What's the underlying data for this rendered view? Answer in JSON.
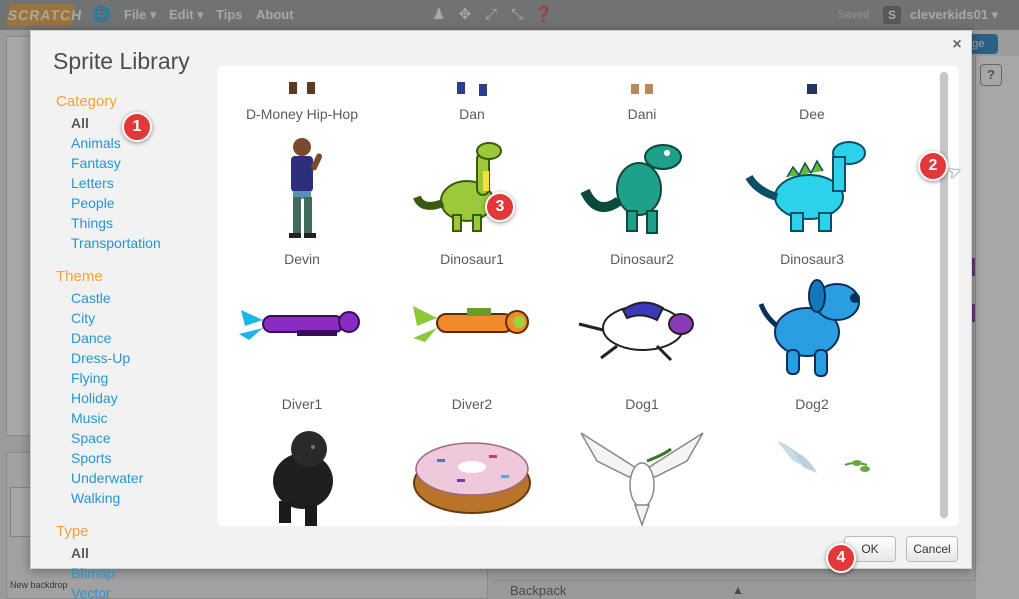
{
  "topbar": {
    "logo": "SCRATCH",
    "menus": [
      "File ▾",
      "Edit ▾",
      "Tips",
      "About"
    ],
    "saved": "Saved",
    "user_initial": "S",
    "username": "cleverkids01 ▾",
    "icons": [
      "globe-icon",
      "stamp-icon",
      "arrows-out-icon",
      "grow-icon",
      "shrink-icon",
      "help-circle-icon"
    ]
  },
  "editor": {
    "new_backdrop": "New backdrop",
    "backpack": "Backpack",
    "stage_button": "age",
    "help": "?"
  },
  "dialog": {
    "title": "Sprite Library",
    "close": "×",
    "ok": "OK",
    "cancel": "Cancel"
  },
  "filters": {
    "category_heading": "Category",
    "categories": [
      "All",
      "Animals",
      "Fantasy",
      "Letters",
      "People",
      "Things",
      "Transportation"
    ],
    "theme_heading": "Theme",
    "themes": [
      "Castle",
      "City",
      "Dance",
      "Dress-Up",
      "Flying",
      "Holiday",
      "Music",
      "Space",
      "Sports",
      "Underwater",
      "Walking"
    ],
    "type_heading": "Type",
    "types": [
      "All",
      "Bitmap",
      "Vector"
    ]
  },
  "sprites": {
    "row0": [
      "D-Money Hip-Hop",
      "Dan",
      "Dani",
      "Dee"
    ],
    "row1": [
      "Devin",
      "Dinosaur1",
      "Dinosaur2",
      "Dinosaur3"
    ],
    "row2": [
      "Diver1",
      "Diver2",
      "Dog1",
      "Dog2"
    ],
    "row3": [
      "",
      "",
      "",
      ""
    ]
  },
  "steps": [
    "1",
    "2",
    "3",
    "4"
  ],
  "colors": {
    "heading_orange": "#f6a234",
    "link_blue": "#2596d2",
    "step_red": "#e2383a"
  }
}
